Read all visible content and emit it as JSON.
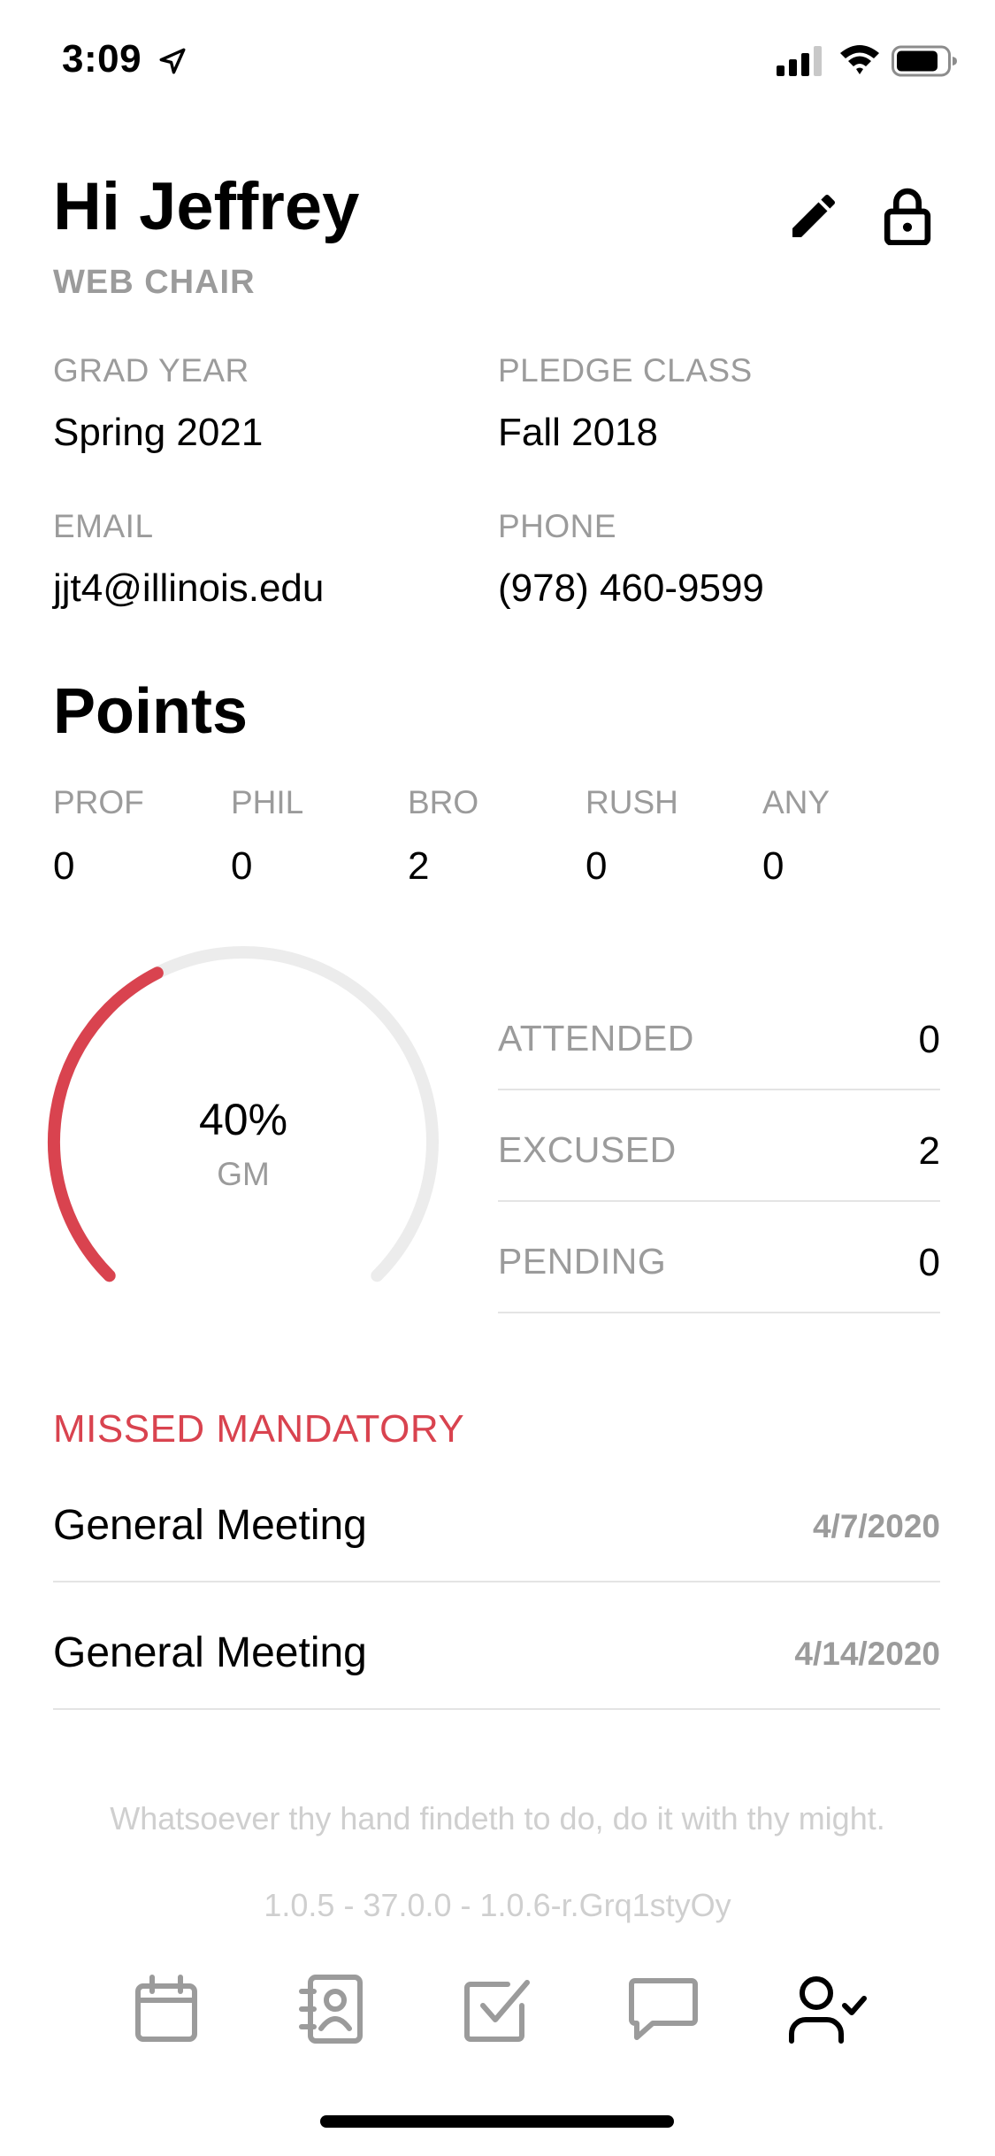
{
  "status_bar": {
    "time": "3:09"
  },
  "header": {
    "greeting": "Hi Jeffrey",
    "role": "WEB CHAIR"
  },
  "profile": {
    "grad_year_label": "GRAD YEAR",
    "grad_year": "Spring 2021",
    "pledge_class_label": "PLEDGE CLASS",
    "pledge_class": "Fall 2018",
    "email_label": "EMAIL",
    "email": "jjt4@illinois.edu",
    "phone_label": "PHONE",
    "phone": "(978) 460-9599"
  },
  "points": {
    "title": "Points",
    "categories": [
      {
        "label": "PROF",
        "value": "0"
      },
      {
        "label": "PHIL",
        "value": "0"
      },
      {
        "label": "BRO",
        "value": "2"
      },
      {
        "label": "RUSH",
        "value": "0"
      },
      {
        "label": "ANY",
        "value": "0"
      }
    ]
  },
  "gauge": {
    "percent_text": "40%",
    "percent": 0.4,
    "label": "GM",
    "fill_color": "#d9434f",
    "track_color": "#ececec"
  },
  "attendance": [
    {
      "label": "ATTENDED",
      "value": "0"
    },
    {
      "label": "EXCUSED",
      "value": "2"
    },
    {
      "label": "PENDING",
      "value": "0"
    }
  ],
  "missed": {
    "title": "MISSED MANDATORY",
    "items": [
      {
        "name": "General Meeting",
        "date": "4/7/2020"
      },
      {
        "name": "General Meeting",
        "date": "4/14/2020"
      }
    ]
  },
  "footer": {
    "motto": "Whatsoever thy hand findeth to do, do it with thy might.",
    "version": "1.0.5 - 37.0.0 - 1.0.6-r.Grq1styOy"
  },
  "tabs": [
    {
      "icon": "calendar-icon",
      "active": false
    },
    {
      "icon": "contacts-icon",
      "active": false
    },
    {
      "icon": "checkbox-icon",
      "active": false
    },
    {
      "icon": "chat-icon",
      "active": false
    },
    {
      "icon": "user-check-icon",
      "active": true
    }
  ],
  "colors": {
    "accent": "#d9434f",
    "muted": "#9b9b9b",
    "inactive_icon": "#9b9b9b",
    "active_icon": "#000000"
  }
}
